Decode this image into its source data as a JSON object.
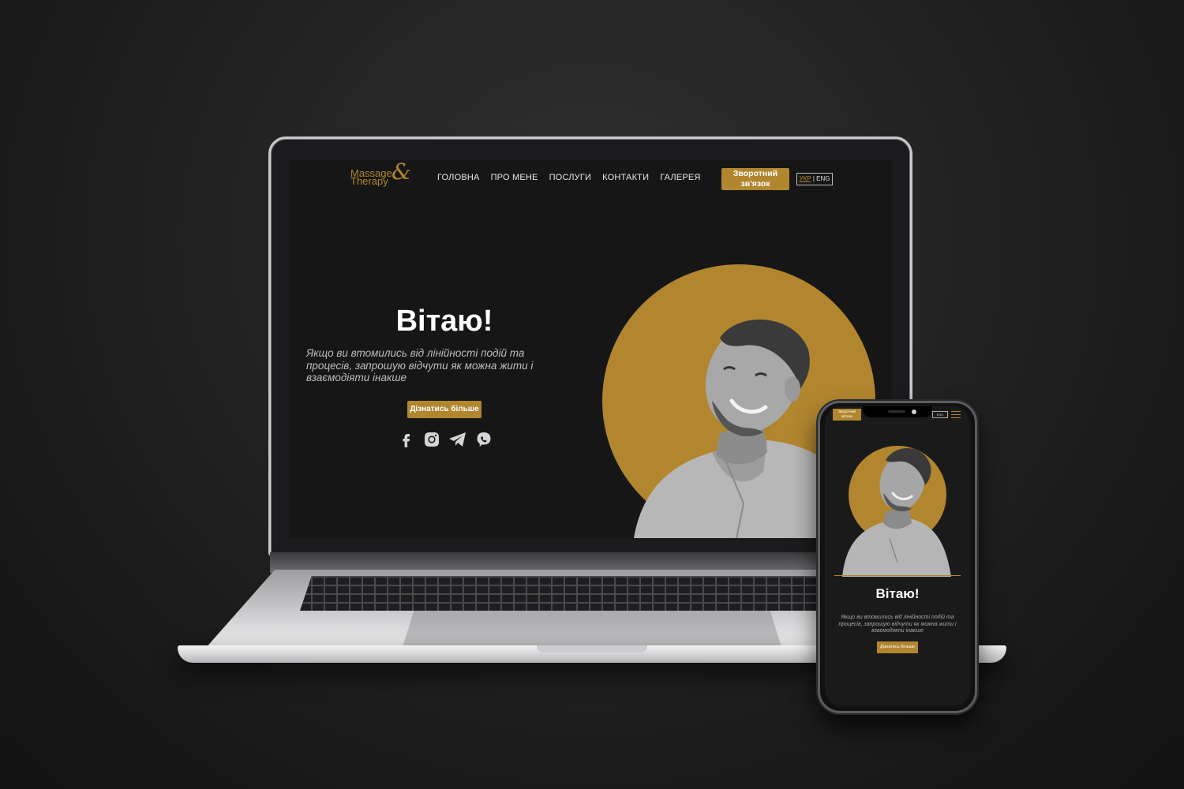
{
  "site": {
    "logo": {
      "line1": "Massage",
      "line2": "Therapy",
      "amp": "&"
    },
    "nav": [
      "ГОЛОВНА",
      "ПРО МЕНЕ",
      "ПОСЛУГИ",
      "КОНТАКТИ",
      "ГАЛЕРЕЯ"
    ],
    "cta": {
      "line1": "Зворотний",
      "line2": "зв'язок"
    },
    "lang": {
      "ukr": "УКР",
      "sep": "|",
      "eng": "ENG"
    },
    "hero": {
      "title": "Вітаю!",
      "text": "Якщо ви втомились від лінійності подій та процесів, запрошую відчути як можна жити і взаємодіяти інакше",
      "button": "Дізнатись більше"
    },
    "socials": [
      "facebook-icon",
      "instagram-icon",
      "telegram-icon",
      "viber-icon"
    ]
  },
  "phone": {
    "cta": {
      "line1": "Зворотний",
      "line2": "зв'язок"
    },
    "lang": "ENG",
    "title": "Вітаю!",
    "text": "Якщо ви втомились від лінійності подій та процесів, запрошую відчути як можна жити і взаємодіяти інакше",
    "button": "Дізнатись більше"
  },
  "colors": {
    "accent": "#b1862f",
    "background": "#161616",
    "text": "#ffffff"
  }
}
